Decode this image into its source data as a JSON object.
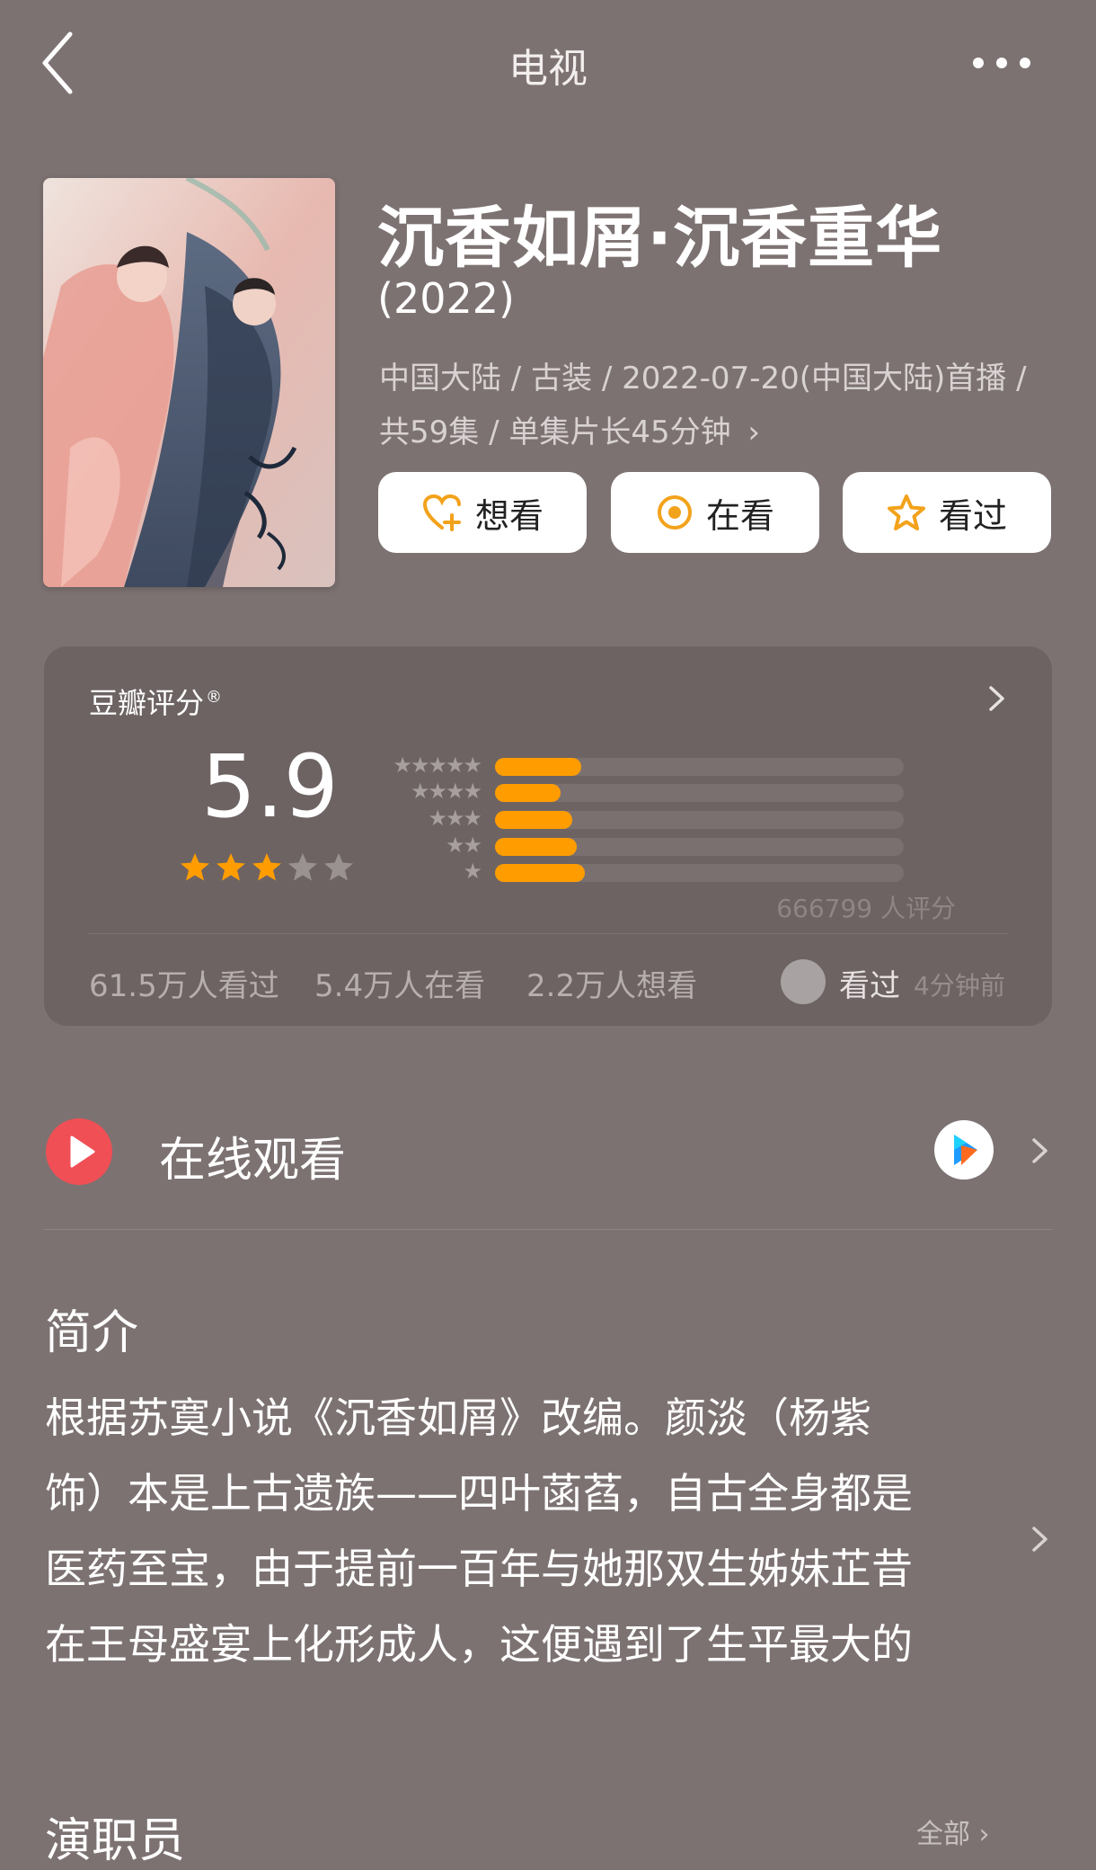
{
  "header": {
    "title": "电视"
  },
  "show": {
    "title": "沉香如屑·沉香重华",
    "year": "(2022)",
    "meta_line_1": "中国大陆 / 古装 / 2022-07-20(中国大陆)首播 /",
    "meta_line_2": "共59集 / 单集片长45分钟",
    "poster_icon": "poster-image"
  },
  "actions": [
    {
      "label": "想看",
      "icon": "heart-plus-icon"
    },
    {
      "label": "在看",
      "icon": "target-icon"
    },
    {
      "label": "看过",
      "icon": "star-outline-icon"
    }
  ],
  "rating": {
    "label": "豆瓣评分",
    "registered_mark": "®",
    "score": "5.9",
    "stars_filled": 3,
    "stars_total": 5,
    "distribution": [
      {
        "stars": 5,
        "fraction": 0.21
      },
      {
        "stars": 4,
        "fraction": 0.16
      },
      {
        "stars": 3,
        "fraction": 0.19
      },
      {
        "stars": 2,
        "fraction": 0.2
      },
      {
        "stars": 1,
        "fraction": 0.22
      }
    ],
    "count": "666799 人评分",
    "stats": {
      "watched": "61.5万人看过",
      "watching": "5.4万人在看",
      "want": "2.2万人想看"
    },
    "friend": {
      "status": "看过",
      "time": "4分钟前"
    }
  },
  "watch": {
    "label": "在线观看",
    "platform_icon": "youku-icon"
  },
  "synopsis": {
    "heading": "简介",
    "lines": [
      "根据苏寞小说《沉香如屑》改编。颜淡（杨紫",
      "饰）本是上古遗族——四叶菡萏，自古全身都是",
      "医药至宝，由于提前一百年与她那双生姊妹芷昔",
      "在王母盛宴上化形成人，这便遇到了生平最大的"
    ]
  },
  "next_section": {
    "heading": "演职员",
    "link": "全部"
  },
  "colors": {
    "background": "#7d7272",
    "card": "#6d6363",
    "accent": "#ff9d00",
    "play": "#ef4f55"
  }
}
